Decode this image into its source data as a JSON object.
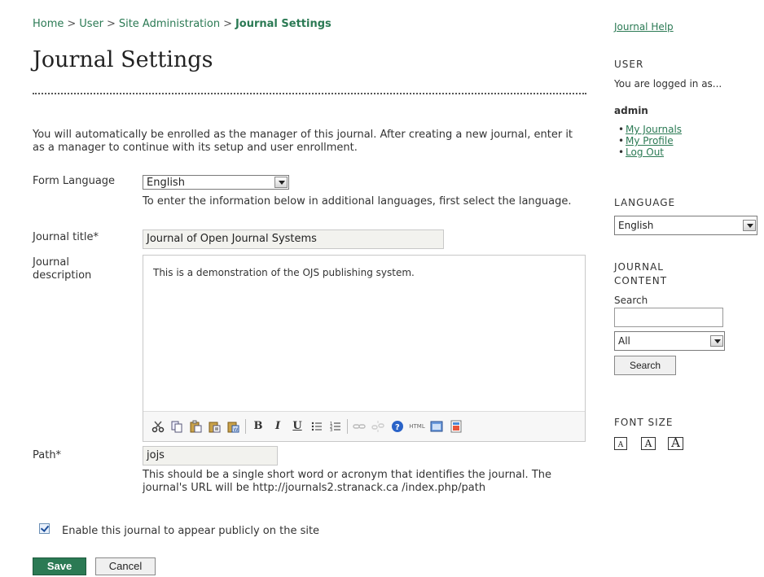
{
  "breadcrumb": {
    "home": "Home",
    "user": "User",
    "site_admin": "Site Administration",
    "current": "Journal Settings",
    "separator": ">"
  },
  "page": {
    "title": "Journal Settings",
    "intro": "You will automatically be enrolled as the manager of this journal. After creating a new journal, enter it as a manager to continue with its setup and user enrollment."
  },
  "form": {
    "form_language_label": "Form Language",
    "form_language_value": "English",
    "form_language_hint": "To enter the information below in additional languages, first select the language.",
    "journal_title_label": "Journal title*",
    "journal_title_value": "Journal of Open Journal Systems",
    "journal_description_label": "Journal description",
    "journal_description_value": "This is a demonstration of the OJS publishing system.",
    "path_label": "Path*",
    "path_value": "jojs",
    "path_hint": "This should be a single short word or acronym that identifies the journal. The journal's URL will be http://journals2.stranack.ca /index.php/path",
    "enable_label": "Enable this journal to appear publicly on the site",
    "enable_checked": true,
    "save_label": "Save",
    "cancel_label": "Cancel"
  },
  "editor_toolbar": {
    "bold": "B",
    "italic": "I",
    "underline": "U",
    "html": "HTML"
  },
  "sidebar": {
    "help_link": "Journal Help",
    "user_heading": "USER",
    "logged_in_text": "You are logged in as...",
    "username": "admin",
    "user_links": [
      "My Journals",
      "My Profile",
      "Log Out"
    ],
    "language_heading": "LANGUAGE",
    "language_value": "English",
    "journal_content_heading": "JOURNAL CONTENT",
    "search_label": "Search",
    "search_scope": "All",
    "search_button": "Search",
    "font_size_heading": "FONT SIZE",
    "font_sizes": [
      "A",
      "A",
      "A"
    ]
  },
  "colors": {
    "link_green": "#2b7a54",
    "save_button": "#2b7a54"
  }
}
